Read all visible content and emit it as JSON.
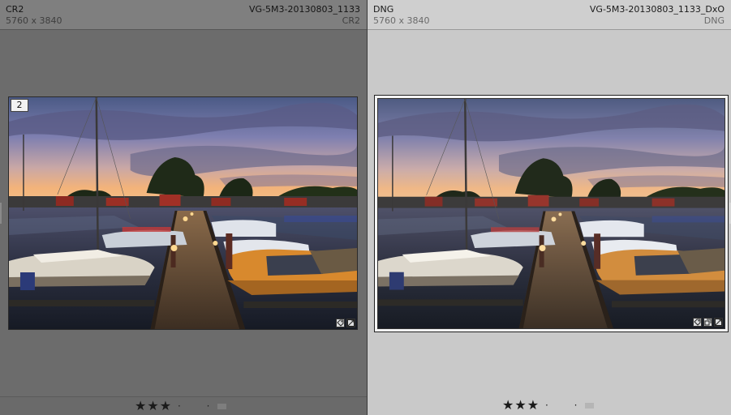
{
  "left": {
    "format": "CR2",
    "filename": "VG-5M3-20130803_1133",
    "dimensions": "5760 x 3840",
    "extension": "CR2",
    "badge": "2",
    "rating": "★★★",
    "rating_dots": "· ·",
    "icons": [
      "keyword-tag-icon",
      "develop-adjusted-icon"
    ]
  },
  "right": {
    "format": "DNG",
    "filename": "VG-5M3-20130803_1133_DxO",
    "dimensions": "5760 x 3840",
    "extension": "DNG",
    "rating": "★★★",
    "rating_dots": "· ·",
    "icons": [
      "keyword-tag-icon",
      "crop-icon",
      "develop-adjusted-icon"
    ]
  },
  "colors": {
    "left_pane_bg": "#6c6c6c",
    "right_pane_bg": "#c9c9c9",
    "selected_frame_bg": "#f4f4f4"
  }
}
